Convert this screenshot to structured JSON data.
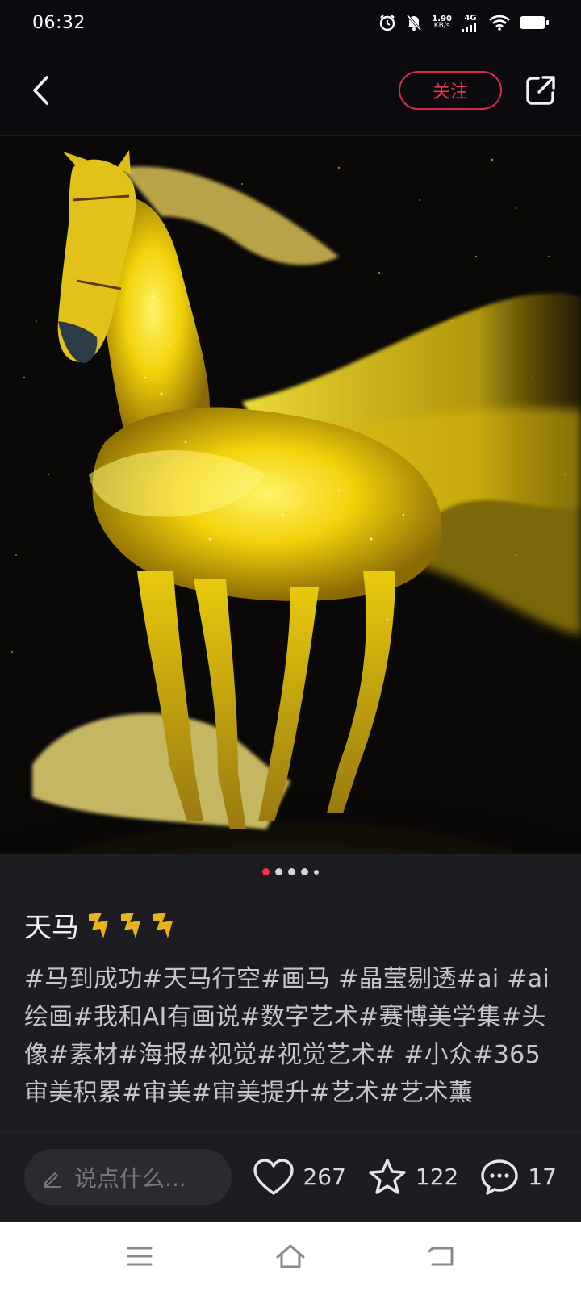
{
  "status_bar": {
    "time": "06:32",
    "net_speed_value": "1.90",
    "net_speed_unit": "KB/s",
    "network": "4G",
    "icons": [
      "alarm-icon",
      "mute-icon",
      "signal-icon",
      "wifi-icon",
      "battery-icon"
    ]
  },
  "header": {
    "follow_label": "关注",
    "accent_color": "#f0334f"
  },
  "gallery": {
    "total_dots": 5,
    "active_index": 0
  },
  "post": {
    "title": "天马",
    "title_emoji": [
      "lightning-icon",
      "lightning-icon",
      "lightning-icon"
    ],
    "body": "#马到成功#天马行空#画马 #晶莹剔透#ai #ai绘画#我和AI有画说#数字艺术#赛博美学集#头像#素材#海报#视觉#视觉艺术# #小众#365审美积累#审美#审美提升#艺术#艺术薰"
  },
  "actions": {
    "comment_placeholder": "说点什么...",
    "likes": "267",
    "favorites": "122",
    "comments": "17"
  }
}
